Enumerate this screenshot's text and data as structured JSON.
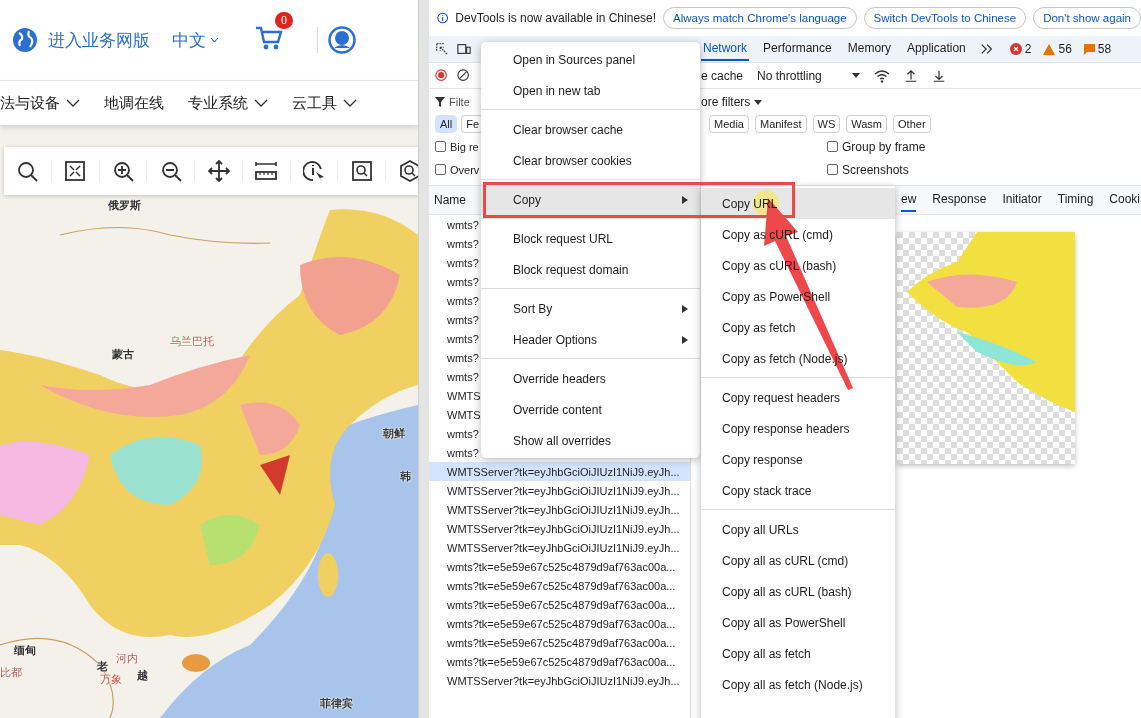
{
  "website": {
    "header": {
      "business_link": "进入业务网版",
      "language": "中文",
      "cart_count": "0"
    },
    "nav": [
      {
        "label": "法与设备",
        "dropdown": true
      },
      {
        "label": "地调在线",
        "dropdown": false
      },
      {
        "label": "专业系统",
        "dropdown": true
      },
      {
        "label": "云工具",
        "dropdown": true
      }
    ],
    "map_labels": [
      {
        "text": "俄罗斯",
        "kind": "country"
      },
      {
        "text": "乌兰巴托",
        "kind": "capital"
      },
      {
        "text": "蒙古",
        "kind": "country"
      },
      {
        "text": "朝鲜",
        "kind": "country"
      },
      {
        "text": "韩",
        "kind": "country"
      },
      {
        "text": "缅甸",
        "kind": "country"
      },
      {
        "text": "比都",
        "kind": "capital"
      },
      {
        "text": "河内",
        "kind": "capital"
      },
      {
        "text": "老",
        "kind": "country"
      },
      {
        "text": "万象",
        "kind": "capital"
      },
      {
        "text": "越",
        "kind": "country"
      },
      {
        "text": "菲律宾",
        "kind": "country"
      }
    ]
  },
  "devtools": {
    "infobar": {
      "message": "DevTools is now available in Chinese!",
      "buttons": [
        "Always match Chrome's language",
        "Switch DevTools to Chinese",
        "Don't show again"
      ]
    },
    "tabs": [
      {
        "label": "Network",
        "selected": true
      },
      {
        "label": "Performance",
        "selected": false
      },
      {
        "label": "Memory",
        "selected": false
      },
      {
        "label": "Application",
        "selected": false
      }
    ],
    "counts": {
      "errors": "2",
      "warnings": "56",
      "issues": "58"
    },
    "toolbar": {
      "cache_label": "e cache",
      "throttling": "No throttling"
    },
    "filter": {
      "placeholder": "Filte",
      "more_filters": "ore filters"
    },
    "type_filters": [
      {
        "label": "All",
        "selected": true
      },
      {
        "label": "Fe",
        "selected": false
      },
      {
        "label": "Media",
        "selected": false
      },
      {
        "label": "Manifest",
        "selected": false
      },
      {
        "label": "WS",
        "selected": false
      },
      {
        "label": "Wasm",
        "selected": false
      },
      {
        "label": "Other",
        "selected": false
      }
    ],
    "options": [
      {
        "label": "Big re",
        "checked": false
      },
      {
        "label": "Group by frame",
        "checked": false
      },
      {
        "label": "Overv",
        "checked": false
      },
      {
        "label": "Screenshots",
        "checked": false
      }
    ],
    "requests": {
      "column": "Name",
      "rows": [
        {
          "name": "wmts?",
          "selected": false
        },
        {
          "name": "wmts?",
          "selected": false
        },
        {
          "name": "wmts?",
          "selected": false
        },
        {
          "name": "wmts?",
          "selected": false
        },
        {
          "name": "wmts?",
          "selected": false
        },
        {
          "name": "wmts?",
          "selected": false
        },
        {
          "name": "wmts?",
          "selected": false
        },
        {
          "name": "wmts?",
          "selected": false
        },
        {
          "name": "wmts?",
          "selected": false
        },
        {
          "name": "WMTS",
          "selected": false
        },
        {
          "name": "WMTS",
          "selected": false
        },
        {
          "name": "wmts?",
          "selected": false
        },
        {
          "name": "wmts?",
          "selected": false
        },
        {
          "name": "WMTSServer?tk=eyJhbGciOiJIUzI1NiJ9.eyJh...",
          "selected": true
        },
        {
          "name": "WMTSServer?tk=eyJhbGciOiJIUzI1NiJ9.eyJh...",
          "selected": false
        },
        {
          "name": "WMTSServer?tk=eyJhbGciOiJIUzI1NiJ9.eyJh...",
          "selected": false
        },
        {
          "name": "WMTSServer?tk=eyJhbGciOiJIUzI1NiJ9.eyJh...",
          "selected": false
        },
        {
          "name": "WMTSServer?tk=eyJhbGciOiJIUzI1NiJ9.eyJh...",
          "selected": false
        },
        {
          "name": "wmts?tk=e5e59e67c525c4879d9af763ac00a...",
          "selected": false
        },
        {
          "name": "wmts?tk=e5e59e67c525c4879d9af763ac00a...",
          "selected": false
        },
        {
          "name": "wmts?tk=e5e59e67c525c4879d9af763ac00a...",
          "selected": false
        },
        {
          "name": "wmts?tk=e5e59e67c525c4879d9af763ac00a...",
          "selected": false
        },
        {
          "name": "wmts?tk=e5e59e67c525c4879d9af763ac00a...",
          "selected": false
        },
        {
          "name": "wmts?tk=e5e59e67c525c4879d9af763ac00a...",
          "selected": false
        },
        {
          "name": "WMTSServer?tk=eyJhbGciOiJIUzI1NiJ9.eyJh...",
          "selected": false
        }
      ]
    },
    "detail_tabs": [
      {
        "label": "ew",
        "selected": true
      },
      {
        "label": "Response",
        "selected": false
      },
      {
        "label": "Initiator",
        "selected": false
      },
      {
        "label": "Timing",
        "selected": false
      },
      {
        "label": "Cooki",
        "selected": false
      }
    ]
  },
  "context_menu": {
    "groups": [
      [
        {
          "label": "Open in Sources panel",
          "has_submenu": false,
          "selected": false
        },
        {
          "label": "Open in new tab",
          "has_submenu": false,
          "selected": false
        }
      ],
      [
        {
          "label": "Clear browser cache",
          "has_submenu": false,
          "selected": false
        },
        {
          "label": "Clear browser cookies",
          "has_submenu": false,
          "selected": false
        }
      ],
      [
        {
          "label": "Copy",
          "has_submenu": true,
          "selected": true
        }
      ],
      [
        {
          "label": "Block request URL",
          "has_submenu": false,
          "selected": false
        },
        {
          "label": "Block request domain",
          "has_submenu": false,
          "selected": false
        }
      ],
      [
        {
          "label": "Sort By",
          "has_submenu": true,
          "selected": false
        },
        {
          "label": "Header Options",
          "has_submenu": true,
          "selected": false
        }
      ],
      [
        {
          "label": "Override headers",
          "has_submenu": false,
          "selected": false
        },
        {
          "label": "Override content",
          "has_submenu": false,
          "selected": false
        },
        {
          "label": "Show all overrides",
          "has_submenu": false,
          "selected": false
        }
      ]
    ]
  },
  "copy_submenu": {
    "groups": [
      [
        {
          "label": "Copy URL",
          "selected": true
        },
        {
          "label": "Copy as cURL (cmd)",
          "selected": false
        },
        {
          "label": "Copy as cURL (bash)",
          "selected": false
        },
        {
          "label": "Copy as PowerShell",
          "selected": false
        },
        {
          "label": "Copy as fetch",
          "selected": false
        },
        {
          "label": "Copy as fetch (Node.js)",
          "selected": false
        }
      ],
      [
        {
          "label": "Copy request headers",
          "selected": false
        },
        {
          "label": "Copy response headers",
          "selected": false
        },
        {
          "label": "Copy response",
          "selected": false
        },
        {
          "label": "Copy stack trace",
          "selected": false
        }
      ],
      [
        {
          "label": "Copy all URLs",
          "selected": false
        },
        {
          "label": "Copy all as cURL (cmd)",
          "selected": false
        },
        {
          "label": "Copy all as cURL (bash)",
          "selected": false
        },
        {
          "label": "Copy all as PowerShell",
          "selected": false
        },
        {
          "label": "Copy all as fetch",
          "selected": false
        },
        {
          "label": "Copy all as fetch (Node.js)",
          "selected": false
        }
      ]
    ]
  }
}
